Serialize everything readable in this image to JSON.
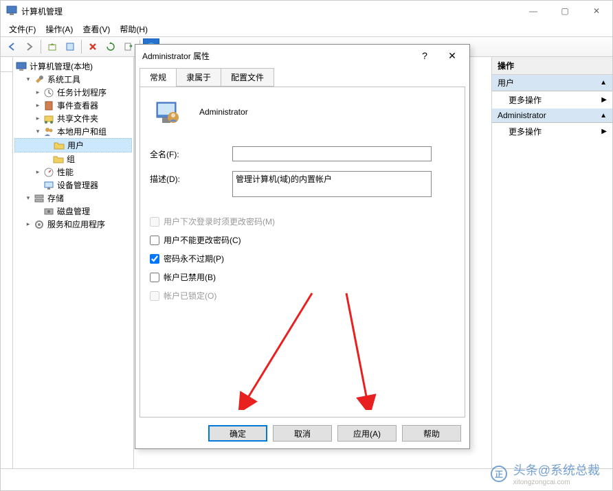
{
  "window": {
    "title": "计算机管理",
    "min": "—",
    "max": "▢",
    "close": "✕"
  },
  "menu": {
    "file": "文件(F)",
    "action": "操作(A)",
    "view": "查看(V)",
    "help": "帮助(H)"
  },
  "tree": {
    "root": "计算机管理(本地)",
    "system_tools": "系统工具",
    "task_scheduler": "任务计划程序",
    "event_viewer": "事件查看器",
    "shared_folders": "共享文件夹",
    "local_users_groups": "本地用户和组",
    "users": "用户",
    "groups": "组",
    "performance": "性能",
    "device_manager": "设备管理器",
    "storage": "存储",
    "disk_management": "磁盘管理",
    "services_apps": "服务和应用程序"
  },
  "right": {
    "header": "操作",
    "section1": "用户",
    "action1": "更多操作",
    "section2": "Administrator",
    "action2": "更多操作"
  },
  "dialog": {
    "title": "Administrator 属性",
    "help": "?",
    "close": "✕",
    "tabs": {
      "general": "常规",
      "memberof": "隶属于",
      "profile": "配置文件"
    },
    "username": "Administrator",
    "fullname_label": "全名(F):",
    "fullname_value": "",
    "description_label": "描述(D):",
    "description_value": "管理计算机(域)的内置帐户",
    "checks": {
      "must_change": "用户下次登录时须更改密码(M)",
      "cannot_change": "用户不能更改密码(C)",
      "never_expires": "密码永不过期(P)",
      "disabled": "帐户已禁用(B)",
      "locked": "帐户已锁定(O)"
    },
    "buttons": {
      "ok": "确定",
      "cancel": "取消",
      "apply": "应用(A)",
      "help": "帮助"
    }
  },
  "watermark": {
    "text": "头条@系统总裁",
    "url": "xitongzongcai.com"
  }
}
